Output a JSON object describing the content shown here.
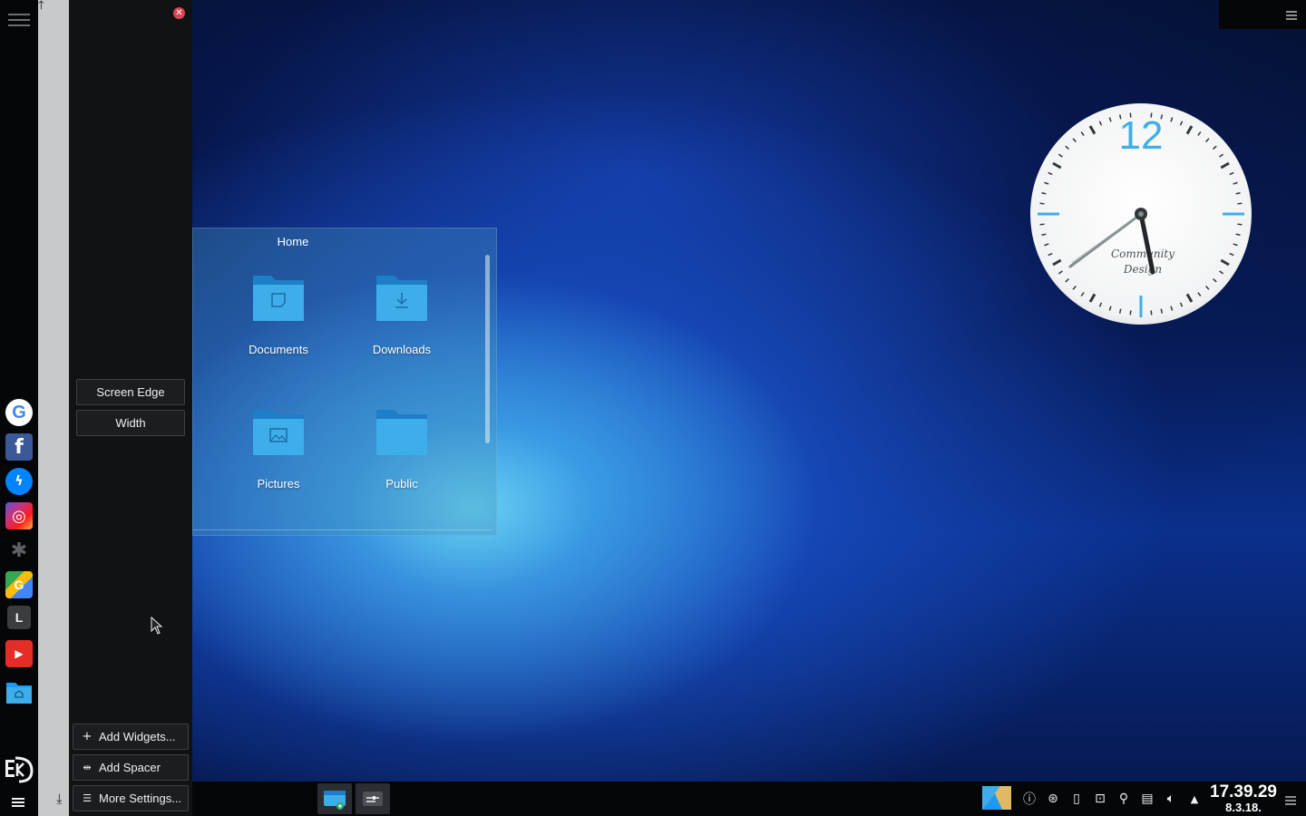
{
  "left_panel": {
    "launchers": [
      {
        "name": "Google",
        "icon": "google-icon",
        "glyph": "G"
      },
      {
        "name": "Facebook",
        "icon": "facebook-icon",
        "glyph": "f"
      },
      {
        "name": "Messenger",
        "icon": "messenger-icon",
        "glyph": "⚡"
      },
      {
        "name": "Instagram",
        "icon": "instagram-icon",
        "glyph": "◎"
      },
      {
        "name": "KDE Connect",
        "icon": "kde-gear-icon",
        "glyph": "✱"
      },
      {
        "name": "Google Maps",
        "icon": "maps-icon",
        "glyph": "G"
      },
      {
        "name": "L",
        "icon": "letter-l-icon",
        "glyph": "L"
      },
      {
        "name": "YouTube",
        "icon": "youtube-icon",
        "glyph": "▶"
      },
      {
        "name": "Home folder",
        "icon": "home-folder-icon",
        "glyph": "⌂"
      }
    ]
  },
  "panel_edit": {
    "screen_edge_label": "Screen Edge",
    "width_label": "Width",
    "add_widgets_label": "Add Widgets...",
    "add_spacer_label": "Add Spacer",
    "more_settings_label": "More Settings..."
  },
  "folder_view": {
    "title": "Home",
    "items": [
      {
        "label": "Documents",
        "icon": "documents-folder-icon"
      },
      {
        "label": "Downloads",
        "icon": "downloads-folder-icon"
      },
      {
        "label": "Pictures",
        "icon": "pictures-folder-icon"
      },
      {
        "label": "Public",
        "icon": "public-folder-icon"
      }
    ]
  },
  "clock": {
    "twelve": "12",
    "brand_line1": "Community",
    "brand_line2": "Design",
    "accent_color": "#3daee9"
  },
  "taskbar": {
    "time": "17.39.29",
    "date": "8.3.18."
  },
  "colors": {
    "accent": "#3daee9",
    "panel_bg": "#050607",
    "edit_panel_bg": "#101214",
    "ruler_bg": "#c8c9cb"
  }
}
